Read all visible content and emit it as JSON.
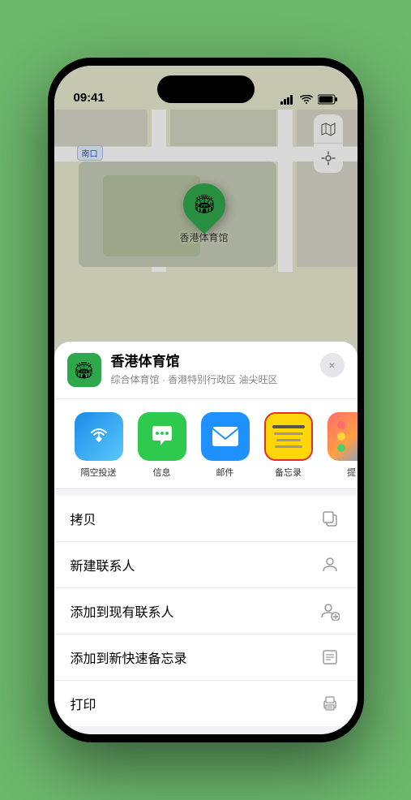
{
  "status_bar": {
    "time": "09:41",
    "location_icon": "▶"
  },
  "map": {
    "label": "南口",
    "pin_label": "香港体育馆",
    "controls": {
      "map_icon": "🗺",
      "location_icon": "↗"
    }
  },
  "place_card": {
    "name": "香港体育馆",
    "description": "综合体育馆 · 香港特别行政区 油尖旺区",
    "close_label": "×"
  },
  "share_apps": [
    {
      "id": "airdrop",
      "label": "隔空投送"
    },
    {
      "id": "messages",
      "label": "信息"
    },
    {
      "id": "mail",
      "label": "邮件"
    },
    {
      "id": "notes",
      "label": "备忘录"
    },
    {
      "id": "more",
      "label": "提"
    }
  ],
  "actions": [
    {
      "id": "copy",
      "label": "拷贝",
      "icon": "copy"
    },
    {
      "id": "new-contact",
      "label": "新建联系人",
      "icon": "person"
    },
    {
      "id": "add-existing",
      "label": "添加到现有联系人",
      "icon": "person-add"
    },
    {
      "id": "quick-note",
      "label": "添加到新快速备忘录",
      "icon": "note"
    },
    {
      "id": "print",
      "label": "打印",
      "icon": "print"
    }
  ]
}
